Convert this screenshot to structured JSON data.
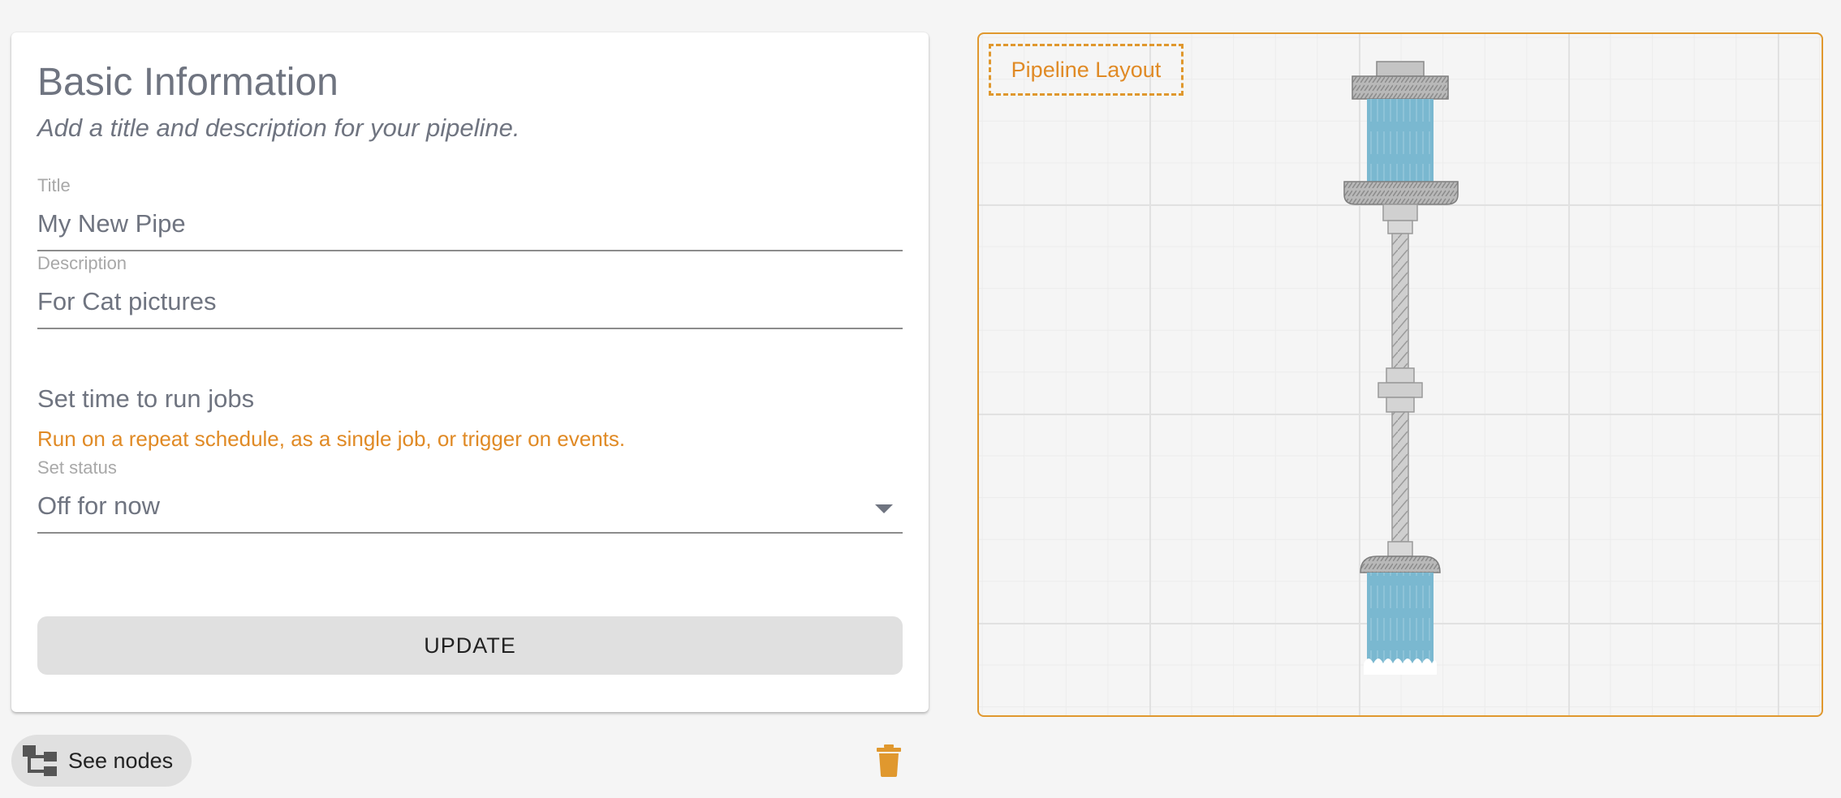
{
  "form": {
    "title": "Basic Information",
    "subtitle": "Add a title and description for your pipeline.",
    "title_field": {
      "label": "Title",
      "value": "My New Pipe"
    },
    "description_field": {
      "label": "Description",
      "value": "For Cat pictures"
    },
    "schedule": {
      "heading": "Set time to run jobs",
      "hint": "Run on a repeat schedule, as a single job, or trigger on events."
    },
    "status_field": {
      "label": "Set status",
      "value": "Off for now"
    },
    "update_label": "UPDATE"
  },
  "actions": {
    "see_nodes_label": "See nodes",
    "see_nodes_icon": "account-tree-icon",
    "delete_icon": "trash-icon"
  },
  "pipeline": {
    "tag_label": "Pipeline Layout"
  },
  "colors": {
    "accent": "#e0982e",
    "hint_text": "#e08a25",
    "water": "#7ab8d0",
    "metal": "#b5b5b5"
  }
}
